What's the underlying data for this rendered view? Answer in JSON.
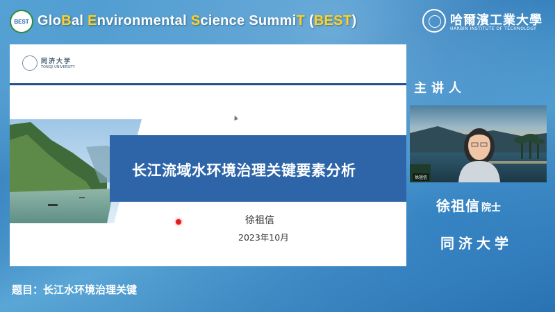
{
  "header": {
    "best_logo_text": "BEST",
    "summit_title": [
      {
        "text": "Glo",
        "hl": false
      },
      {
        "text": "B",
        "hl": true
      },
      {
        "text": "al ",
        "hl": false
      },
      {
        "text": "E",
        "hl": true
      },
      {
        "text": "nvironmental ",
        "hl": false
      },
      {
        "text": "S",
        "hl": true
      },
      {
        "text": "cience Summi",
        "hl": false
      },
      {
        "text": "T",
        "hl": true
      },
      {
        "text": " (",
        "hl": false
      },
      {
        "text": "BEST",
        "hl": true
      },
      {
        "text": ")",
        "hl": false
      }
    ],
    "university_logo_cn": "哈爾濱工業大學",
    "university_logo_en": "HARBIN INSTITUTE OF TECHNOLOGY"
  },
  "slide": {
    "logo_cn": "同济大学",
    "logo_en": "TONGJI UNIVERSITY",
    "title": "长江流域水环境治理关键要素分析",
    "author": "徐祖信",
    "date": "2023年10月"
  },
  "sidebar": {
    "speaker_label": "主讲人",
    "video_name_tag": "徐祖信",
    "speaker_name": "徐祖信",
    "speaker_title": "院士",
    "speaker_org": "同济大学"
  },
  "footer": {
    "topic": "题目：长江水环境治理关键"
  },
  "colors": {
    "highlight_yellow": "#ffd21f",
    "slide_band_blue": "#2d65a8",
    "laser_red": "#e01e1e"
  }
}
